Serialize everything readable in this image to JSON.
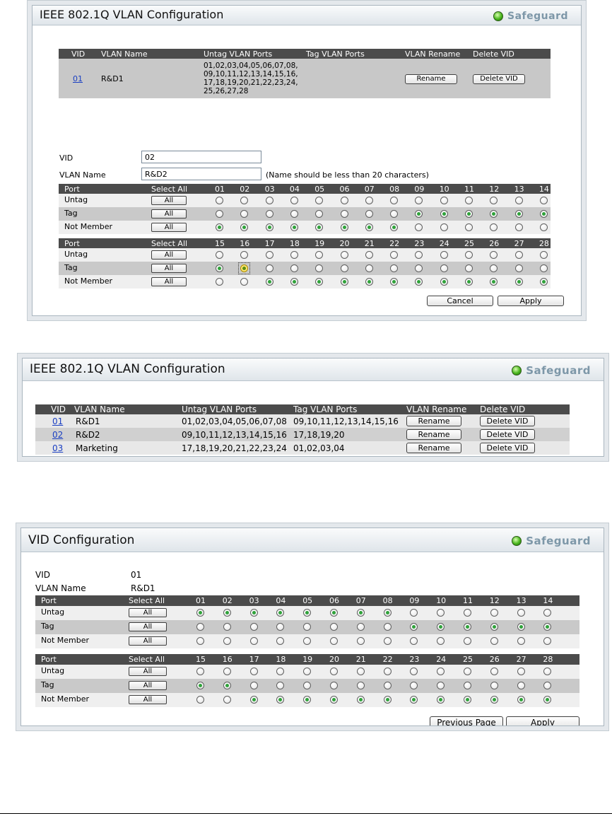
{
  "panel1": {
    "title": "IEEE 802.1Q VLAN Configuration",
    "safeguard": "Safeguard",
    "headers": [
      "VID",
      "VLAN Name",
      "Untag VLAN Ports",
      "Tag VLAN Ports",
      "VLAN Rename",
      "Delete VID"
    ],
    "rows": [
      {
        "vid": "01",
        "name": "R&D1",
        "untag_lines": [
          "01,02,03,04,05,06,07,08,",
          "09,10,11,12,13,14,15,16,",
          "17,18,19,20,21,22,23,24,",
          "25,26,27,28"
        ],
        "tag": "",
        "rename": "Rename",
        "delete": "Delete VID"
      }
    ],
    "vid_label": "VID",
    "vid_value": "02",
    "name_label": "VLAN Name",
    "name_value": "R&D2",
    "name_hint": "(Name should be less than 20 characters)",
    "port_label": "Port",
    "select_all": "Select All",
    "all": "All",
    "row_labels": [
      "Untag",
      "Tag",
      "Not Member"
    ],
    "ports1": [
      "01",
      "02",
      "03",
      "04",
      "05",
      "06",
      "07",
      "08",
      "09",
      "10",
      "11",
      "12",
      "13",
      "14"
    ],
    "ports2": [
      "15",
      "16",
      "17",
      "18",
      "19",
      "20",
      "21",
      "22",
      "23",
      "24",
      "25",
      "26",
      "27",
      "28"
    ],
    "sel1": [
      "NM",
      "NM",
      "NM",
      "NM",
      "NM",
      "NM",
      "NM",
      "NM",
      "T",
      "T",
      "T",
      "T",
      "T",
      "T"
    ],
    "sel2": [
      "T",
      "T",
      "NM",
      "NM",
      "NM",
      "NM",
      "NM",
      "NM",
      "NM",
      "NM",
      "NM",
      "NM",
      "NM",
      "NM"
    ],
    "cancel": "Cancel",
    "apply": "Apply"
  },
  "panel2": {
    "title": "IEEE 802.1Q VLAN Configuration",
    "safeguard": "Safeguard",
    "headers": [
      "VID",
      "VLAN Name",
      "Untag VLAN Ports",
      "Tag VLAN Ports",
      "VLAN Rename",
      "Delete VID"
    ],
    "rows": [
      {
        "vid": "01",
        "name": "R&D1",
        "untag": "01,02,03,04,05,06,07,08",
        "tag": "09,10,11,12,13,14,15,16",
        "rename": "Rename",
        "delete": "Delete VID"
      },
      {
        "vid": "02",
        "name": "R&D2",
        "untag": "09,10,11,12,13,14,15,16",
        "tag": "17,18,19,20",
        "rename": "Rename",
        "delete": "Delete VID"
      },
      {
        "vid": "03",
        "name": "Marketing",
        "untag": "17,18,19,20,21,22,23,24",
        "tag": "01,02,03,04",
        "rename": "Rename",
        "delete": "Delete VID"
      }
    ]
  },
  "panel3": {
    "title": "VID Configuration",
    "safeguard": "Safeguard",
    "vid_label": "VID",
    "vid_value": "01",
    "name_label": "VLAN Name",
    "name_value": "R&D1",
    "port_label": "Port",
    "select_all": "Select All",
    "all": "All",
    "row_labels": [
      "Untag",
      "Tag",
      "Not Member"
    ],
    "ports1": [
      "01",
      "02",
      "03",
      "04",
      "05",
      "06",
      "07",
      "08",
      "09",
      "10",
      "11",
      "12",
      "13",
      "14"
    ],
    "ports2": [
      "15",
      "16",
      "17",
      "18",
      "19",
      "20",
      "21",
      "22",
      "23",
      "24",
      "25",
      "26",
      "27",
      "28"
    ],
    "sel1": [
      "U",
      "U",
      "U",
      "U",
      "U",
      "U",
      "U",
      "U",
      "T",
      "T",
      "T",
      "T",
      "T",
      "T"
    ],
    "sel2": [
      "T",
      "T",
      "NM",
      "NM",
      "NM",
      "NM",
      "NM",
      "NM",
      "NM",
      "NM",
      "NM",
      "NM",
      "NM",
      "NM"
    ],
    "prev": "Previous Page",
    "apply": "Apply"
  }
}
